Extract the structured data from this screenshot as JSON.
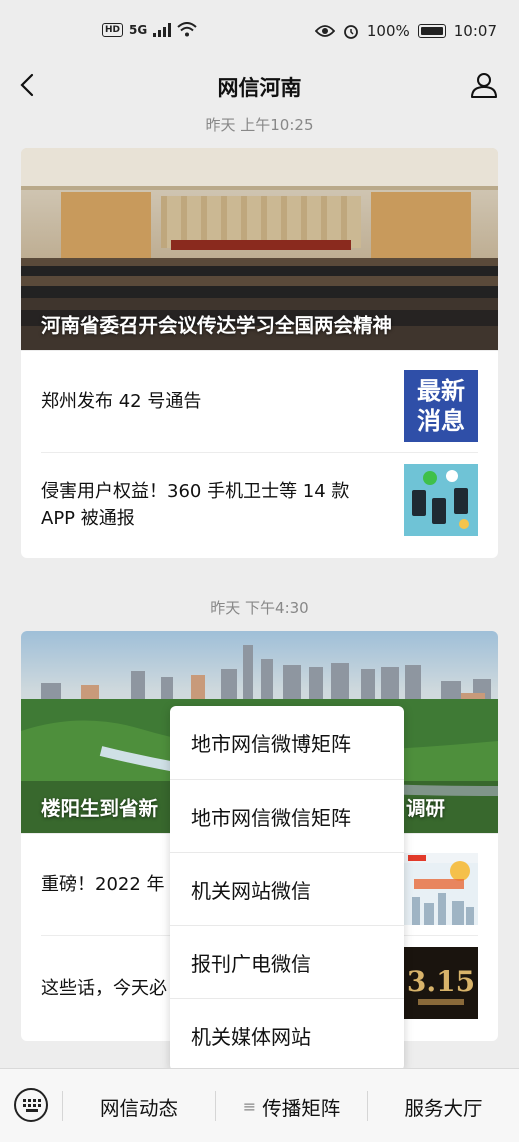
{
  "status_bar": {
    "hd": "HD",
    "network": "5G",
    "battery_text": "100%",
    "time": "10:07"
  },
  "nav": {
    "title": "网信河南"
  },
  "feed": [
    {
      "timestamp": "昨天 上午10:25",
      "hero_title": "河南省委召开会议传达学习全国两会精神",
      "items": [
        {
          "title": "郑州发布 42 号通告",
          "thumb_text": [
            "最新",
            "消息"
          ]
        },
        {
          "title": "侵害用户权益！360 手机卫士等 14 款 APP 被通报"
        }
      ]
    },
    {
      "timestamp": "昨天 下午4:30",
      "hero_title_left": "楼阳生到省新",
      "hero_title_right": "调研",
      "items": [
        {
          "title": "重磅！2022 年"
        },
        {
          "title": "这些话，今天必"
        }
      ]
    }
  ],
  "popup_menu": [
    "地市网信微博矩阵",
    "地市网信微信矩阵",
    "机关网站微信",
    "报刊广电微信",
    "机关媒体网站"
  ],
  "bottom_tabs": [
    "网信动态",
    "传播矩阵",
    "服务大厅"
  ],
  "colors": {
    "accent_blue": "#2f4fa8"
  }
}
